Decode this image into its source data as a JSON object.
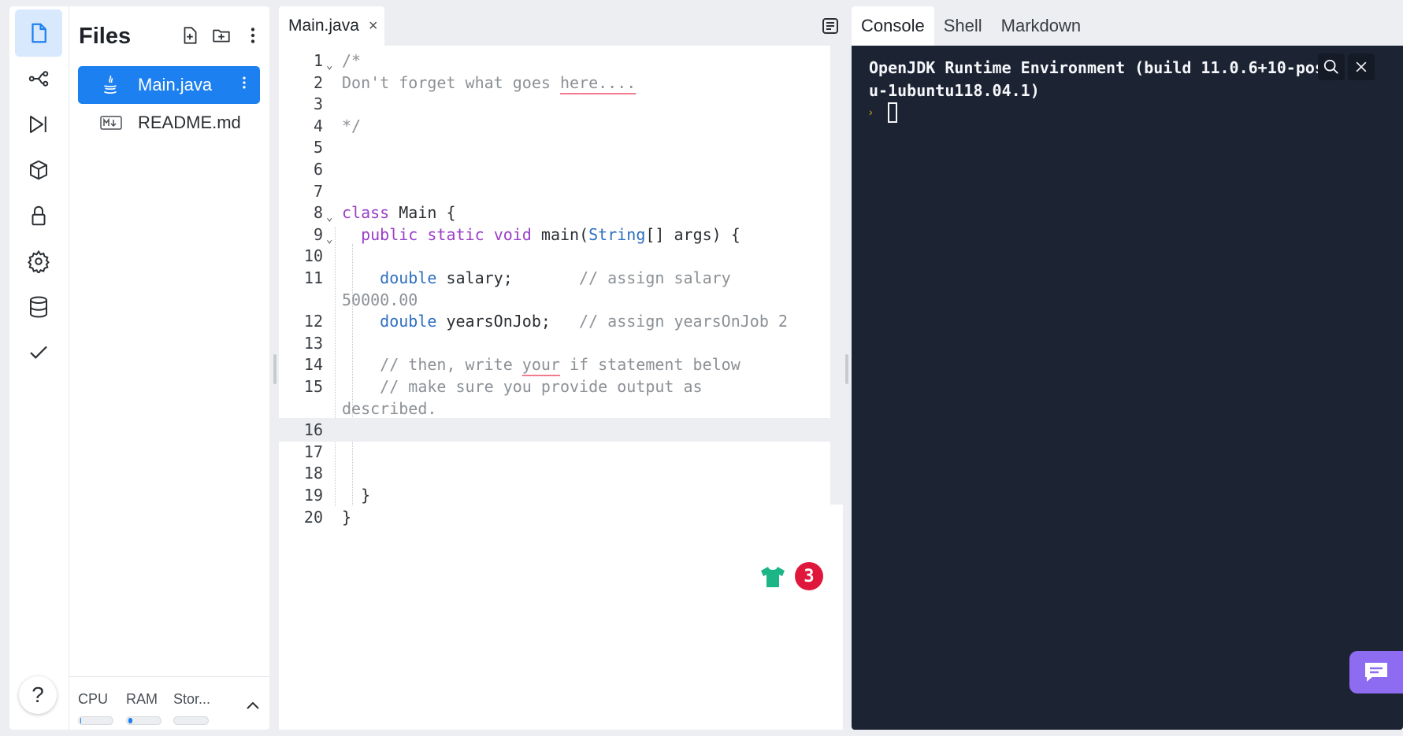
{
  "activity_bar": {
    "items": [
      "files",
      "git",
      "debugger",
      "packages",
      "secrets",
      "settings",
      "database",
      "unit-tests"
    ],
    "help_label": "?"
  },
  "files_panel": {
    "title": "Files",
    "files": [
      {
        "name": "Main.java",
        "icon": "java-icon"
      },
      {
        "name": "README.md",
        "icon": "markdown-icon"
      }
    ],
    "resources": {
      "cpu_label": "CPU",
      "ram_label": "RAM",
      "storage_label": "Stor...",
      "cpu_usage": 0.02,
      "ram_usage": 0.12,
      "storage_usage": 0.0
    },
    "expand_label": "^"
  },
  "editor": {
    "tab_label": "Main.java",
    "tab_close": "×",
    "badge_count": "3",
    "lines": [
      {
        "n": "1",
        "text": "/*"
      },
      {
        "n": "2",
        "text": "Don't forget what goes here...."
      },
      {
        "n": "3",
        "text": ""
      },
      {
        "n": "4",
        "text": "*/"
      },
      {
        "n": "5",
        "text": ""
      },
      {
        "n": "6",
        "text": ""
      },
      {
        "n": "7",
        "text": ""
      },
      {
        "n": "8",
        "text": "class Main {"
      },
      {
        "n": "9",
        "text": "  public static void main(String[] args) {"
      },
      {
        "n": "10",
        "text": ""
      },
      {
        "n": "11",
        "text": "    double salary;       // assign salary"
      },
      {
        "n": "",
        "text": "50000.00"
      },
      {
        "n": "12",
        "text": "    double yearsOnJob;   // assign yearsOnJob 2"
      },
      {
        "n": "13",
        "text": ""
      },
      {
        "n": "14",
        "text": "    // then, write your if statement below"
      },
      {
        "n": "15",
        "text": "    // make sure you provide output as"
      },
      {
        "n": "",
        "text": "described."
      },
      {
        "n": "16",
        "text": ""
      },
      {
        "n": "17",
        "text": ""
      },
      {
        "n": "18",
        "text": ""
      },
      {
        "n": "19",
        "text": "  }"
      },
      {
        "n": "20",
        "text": "}"
      }
    ]
  },
  "console_panel": {
    "tabs": [
      "Console",
      "Shell",
      "Markdown"
    ],
    "output_line1": "OpenJDK Runtime Environment (build 11.0.6+10-post",
    "output_line2": "u-1ubuntu118.04.1)",
    "prompt_symbol": "›"
  },
  "colors": {
    "accent": "#1d80f0",
    "console_bg": "#1c2333",
    "badge": "#e0173d",
    "chat": "#8e6cf2"
  }
}
